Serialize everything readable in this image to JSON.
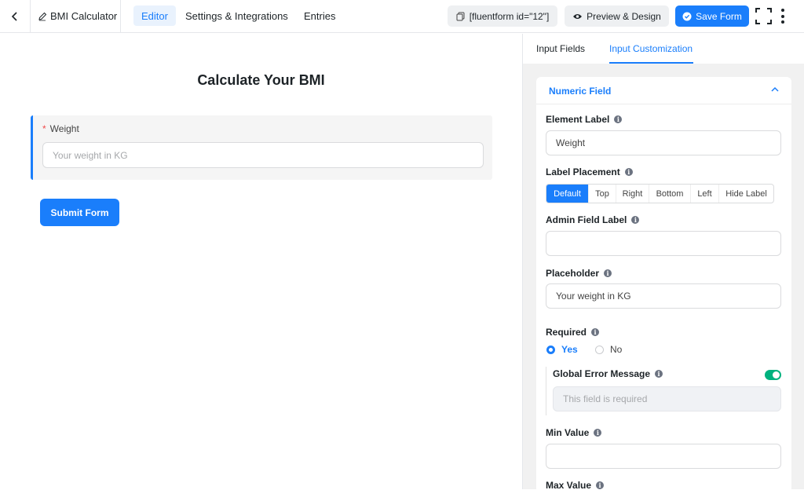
{
  "header": {
    "form_name": "BMI Calculator",
    "tabs": [
      {
        "label": "Editor",
        "active": true
      },
      {
        "label": "Settings & Integrations",
        "active": false
      },
      {
        "label": "Entries",
        "active": false
      }
    ],
    "shortcode": "[fluentform id=\"12\"]",
    "preview_label": "Preview & Design",
    "save_label": "Save Form"
  },
  "canvas": {
    "form_title": "Calculate Your BMI",
    "field": {
      "required_mark": "*",
      "label": "Weight",
      "placeholder": "Your weight in KG"
    },
    "submit_label": "Submit Form"
  },
  "panel": {
    "tabs": [
      {
        "label": "Input Fields",
        "active": false
      },
      {
        "label": "Input Customization",
        "active": true
      }
    ],
    "section_title": "Numeric Field",
    "element_label": {
      "label": "Element Label",
      "value": "Weight"
    },
    "label_placement": {
      "label": "Label Placement",
      "options": [
        "Default",
        "Top",
        "Right",
        "Bottom",
        "Left",
        "Hide Label"
      ],
      "selected": "Default"
    },
    "admin_field_label": {
      "label": "Admin Field Label",
      "value": ""
    },
    "placeholder": {
      "label": "Placeholder",
      "value": "Your weight in KG"
    },
    "required": {
      "label": "Required",
      "yes": "Yes",
      "no": "No",
      "selected": "Yes"
    },
    "global_error": {
      "label": "Global Error Message",
      "enabled": true,
      "placeholder": "This field is required"
    },
    "min_value": {
      "label": "Min Value",
      "value": ""
    },
    "max_value": {
      "label": "Max Value"
    }
  },
  "colors": {
    "accent": "#1a7efb",
    "toggle_on": "#00b27f",
    "required": "#f04b4b"
  }
}
